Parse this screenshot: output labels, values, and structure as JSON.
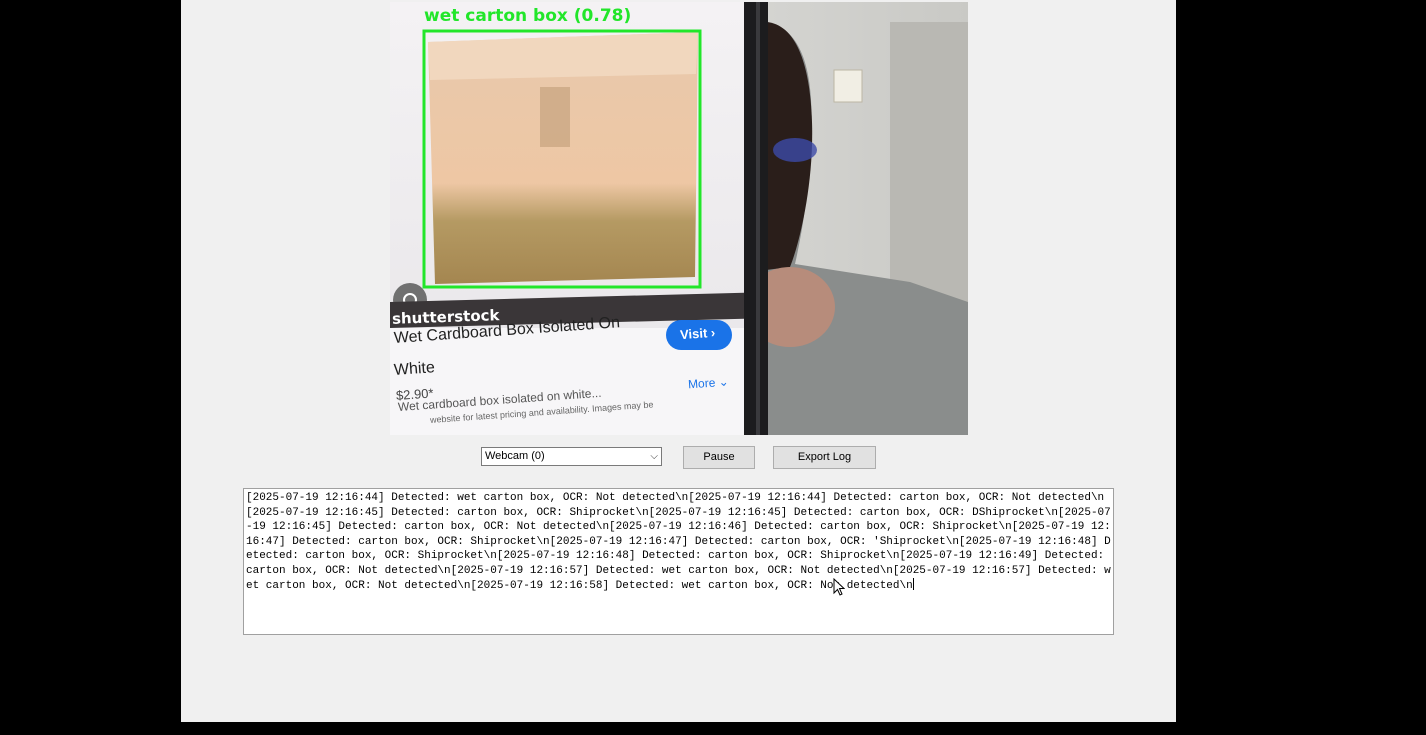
{
  "video": {
    "detection_label": "wet carton box (0.78)",
    "overlay": {
      "watermark": "shutterstock",
      "product_title_line1": "Wet Cardboard Box Isolated On",
      "product_title_line2": "White",
      "price": "$2.90*",
      "visit_label": "Visit ›",
      "more_label": "More ⌄",
      "desc_line1": "Wet cardboard box isolated on white...",
      "desc_line2": "website for latest pricing and availability. Images may be"
    },
    "colors": {
      "bbox": "#22e62a",
      "visit": "#1a73e8"
    }
  },
  "controls": {
    "source_select": "Webcam (0)",
    "pause_label": "Pause",
    "export_label": "Export Log"
  },
  "log": {
    "text": "[2025-07-19 12:16:44] Detected: wet carton box, OCR: Not detected\\n[2025-07-19 12:16:44] Detected: carton box, OCR: Not detected\\n[2025-07-19 12:16:45] Detected: carton box, OCR: Shiprocket\\n[2025-07-19 12:16:45] Detected: carton box, OCR: DShiprocket\\n[2025-07-19 12:16:45] Detected: carton box, OCR: Not detected\\n[2025-07-19 12:16:46] Detected: carton box, OCR: Shiprocket\\n[2025-07-19 12:16:47] Detected: carton box, OCR: Shiprocket\\n[2025-07-19 12:16:47] Detected: carton box, OCR: 'Shiprocket\\n[2025-07-19 12:16:48] Detected: carton box, OCR: Shiprocket\\n[2025-07-19 12:16:48] Detected: carton box, OCR: Shiprocket\\n[2025-07-19 12:16:49] Detected: carton box, OCR: Not detected\\n[2025-07-19 12:16:57] Detected: wet carton box, OCR: Not detected\\n[2025-07-19 12:16:57] Detected: wet carton box, OCR: Not detected\\n[2025-07-19 12:16:58] Detected: wet carton box, OCR: Not detected\\n"
  }
}
